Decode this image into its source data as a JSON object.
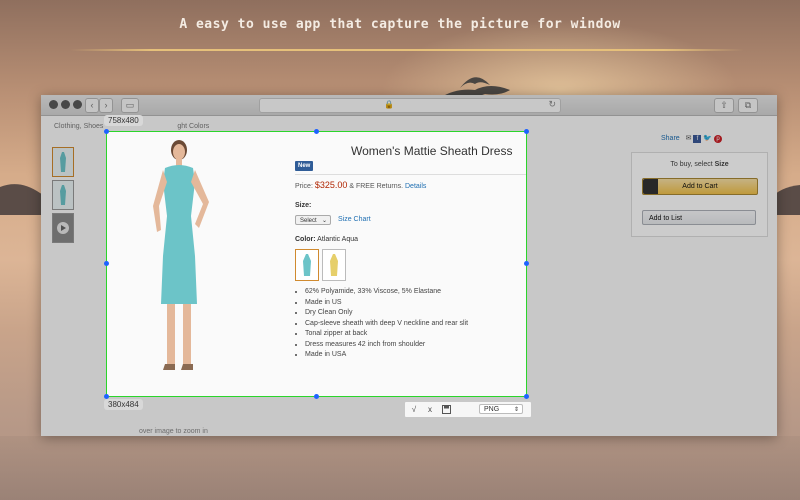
{
  "tagline": "A easy to use app that capture the picture for window",
  "browser": {
    "traffic_lights": [
      "close",
      "minimize",
      "zoom"
    ],
    "nav": {
      "back": "‹",
      "forward": "›"
    }
  },
  "page": {
    "breadcrumb": "Clothing, Shoes",
    "breadcrumb_tail": "ght Colors",
    "product_title": "Women's Mattie Sheath Dress",
    "new_badge": "New",
    "price_label": "Price:",
    "price": "$325.00",
    "price_suffix": "& FREE Returns.",
    "details_link": "Details",
    "size_label": "Size:",
    "size_select": "Select",
    "size_chart_link": "Size Chart",
    "color_label": "Color:",
    "color_value": "Atlantic Aqua",
    "bullets": [
      "62% Polyamide, 33% Viscose, 5% Elastane",
      "Made in US",
      "Dry Clean Only",
      "Cap-sleeve sheath with deep V neckline and rear slit",
      "Tonal zipper at back",
      "Dress measures 42 inch from shoulder",
      "Made in USA"
    ],
    "share_label": "Share",
    "buy_text": "To buy, select",
    "buy_text_bold": "Size",
    "add_to_cart": "Add to Cart",
    "add_to_list": "Add to List",
    "hover_text": "over image to zoom in"
  },
  "capture": {
    "top_dims": "758x480",
    "bottom_dims": "380x484",
    "accept": "√",
    "cancel": "x",
    "format": "PNG"
  },
  "colors": {
    "selection": "#2bd52b",
    "handle": "#1e63ff",
    "price": "#b12704",
    "cart_button": "#f0c14b"
  }
}
